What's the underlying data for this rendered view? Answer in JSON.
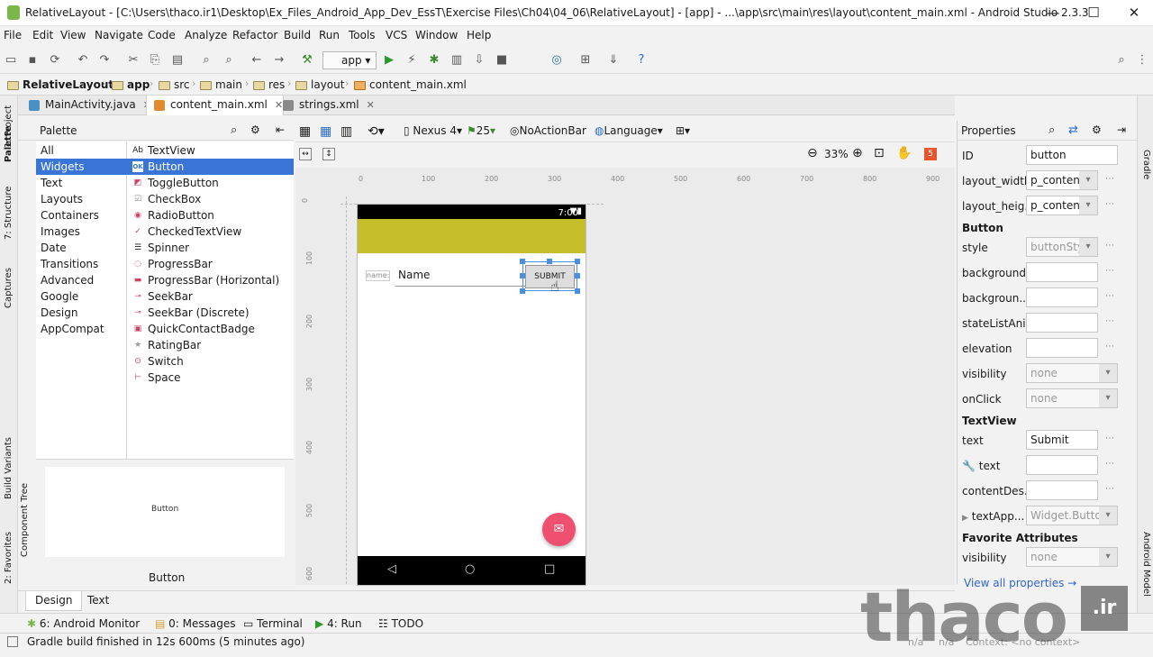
{
  "window": {
    "title": "RelativeLayout - [C:\\Users\\thaco.ir1\\Desktop\\Ex_Files_Android_App_Dev_EssT\\Exercise Files\\Ch04\\04_06\\RelativeLayout] - [app] - ...\\app\\src\\main\\res\\layout\\content_main.xml - Android Studio 2.3.3",
    "minimize": "—",
    "maximize": "☐",
    "close": "✕"
  },
  "menu": [
    "File",
    "Edit",
    "View",
    "Navigate",
    "Code",
    "Analyze",
    "Refactor",
    "Build",
    "Run",
    "Tools",
    "VCS",
    "Window",
    "Help"
  ],
  "toolbar": {
    "run_config": "app"
  },
  "breadcrumb": [
    "RelativeLayout",
    "app",
    "src",
    "main",
    "res",
    "layout",
    "content_main.xml"
  ],
  "left_tabs": [
    "1: Project",
    "Palette",
    "7: Structure",
    "Captures",
    "Build Variants",
    "Component Tree",
    "2: Favorites"
  ],
  "right_tabs": [
    "Gradle",
    "Android Model"
  ],
  "editor_tabs": [
    {
      "label": "MainActivity.java",
      "color": "#4a90c2"
    },
    {
      "label": "content_main.xml",
      "color": "#e08a2e"
    },
    {
      "label": "strings.xml",
      "color": "#8a8a8a"
    }
  ],
  "palette": {
    "title": "Palette",
    "categories": [
      "All",
      "Widgets",
      "Text",
      "Layouts",
      "Containers",
      "Images",
      "Date",
      "Transitions",
      "Advanced",
      "Google",
      "Design",
      "AppCompat"
    ],
    "selected_category": "Widgets",
    "items": [
      {
        "label": "TextView",
        "icon": "Ab"
      },
      {
        "label": "Button",
        "icon": "OK"
      },
      {
        "label": "ToggleButton",
        "icon": "◩"
      },
      {
        "label": "CheckBox",
        "icon": "☑"
      },
      {
        "label": "RadioButton",
        "icon": "◉"
      },
      {
        "label": "CheckedTextView",
        "icon": "✓"
      },
      {
        "label": "Spinner",
        "icon": "☰"
      },
      {
        "label": "ProgressBar",
        "icon": "◌"
      },
      {
        "label": "ProgressBar (Horizontal)",
        "icon": "▬"
      },
      {
        "label": "SeekBar",
        "icon": "⊸"
      },
      {
        "label": "SeekBar (Discrete)",
        "icon": "⊸"
      },
      {
        "label": "QuickContactBadge",
        "icon": "▣"
      },
      {
        "label": "RatingBar",
        "icon": "★"
      },
      {
        "label": "Switch",
        "icon": "⊙"
      },
      {
        "label": "Space",
        "icon": "⊢"
      }
    ],
    "selected_item": "Button",
    "preview_text": "Button",
    "preview_label": "Button"
  },
  "canvas_toolbar": {
    "device": "Nexus 4",
    "api": "25",
    "theme": "NoActionBar",
    "language": "Language",
    "zoom": "33%",
    "warnings": "5"
  },
  "ruler_h": [
    "0",
    "100",
    "200",
    "300",
    "400",
    "500",
    "600",
    "700",
    "800",
    "900"
  ],
  "ruler_v": [
    "0",
    "100",
    "200",
    "300",
    "400",
    "500",
    "600"
  ],
  "device": {
    "time": "7:00",
    "name_label": "name:",
    "name_hint": "Name",
    "button_text": "SUBMIT",
    "appbar_color": "#c7be2b",
    "fab_color": "#f05070",
    "nav_back": "◁",
    "nav_home": "○",
    "nav_recent": "□"
  },
  "properties": {
    "title": "Properties",
    "id_label": "ID",
    "id_value": "button",
    "layout_width_label": "layout_width",
    "layout_width_value": "p_content",
    "layout_height_label": "layout_heig...",
    "layout_height_value": "p_content",
    "button_section": "Button",
    "style_label": "style",
    "style_value": "buttonStyl",
    "background_label": "background",
    "backgroundtint_label": "backgroun...",
    "statelist_label": "stateListAni...",
    "elevation_label": "elevation",
    "visibility_label": "visibility",
    "visibility_value": "none",
    "onclick_label": "onClick",
    "onclick_value": "none",
    "textview_section": "TextView",
    "text_label": "text",
    "text_value": "Submit",
    "text_tools_label": "text",
    "contentdesc_label": "contentDes...",
    "textapp_label": "textApp...",
    "textapp_value": "Widget.Button",
    "fav_section": "Favorite Attributes",
    "fav_visibility_label": "visibility",
    "fav_visibility_value": "none",
    "view_all": "View all properties →"
  },
  "design_tabs": [
    "Design",
    "Text"
  ],
  "tool_windows": [
    "6: Android Monitor",
    "0: Messages",
    "Terminal",
    "4: Run",
    "TODO"
  ],
  "status": {
    "message": "Gradle build finished in 12s 600ms (5 minutes ago)",
    "na1": "n/a",
    "na2": "n/a",
    "context": "Context: <no context>"
  },
  "watermark": {
    "text": "thaco",
    "suffix": ".ir"
  }
}
